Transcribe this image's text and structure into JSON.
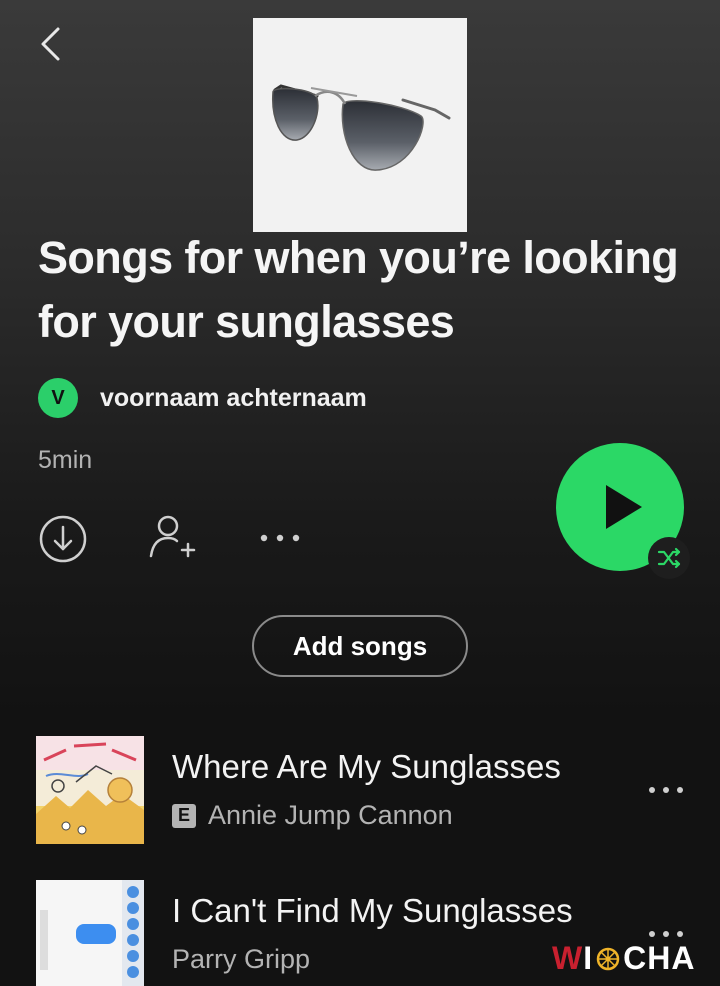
{
  "header": {
    "back_icon": "chevron-left-icon"
  },
  "playlist": {
    "title": "Songs for when you’re looking for your sunglasses",
    "owner_initial": "V",
    "owner_name": "voornaam achternaam",
    "duration": "5min"
  },
  "actions": {
    "download_icon": "download-icon",
    "add_user_icon": "add-user-icon",
    "more_icon": "more-horizontal-icon",
    "play_icon": "play-icon",
    "shuffle_icon": "shuffle-icon",
    "add_songs_label": "Add songs"
  },
  "tracks": [
    {
      "title": "Where Are My Sunglasses",
      "explicit_badge": "E",
      "artist": "Annie Jump Cannon"
    },
    {
      "title": "I Can't Find My Sunglasses",
      "artist": "Parry Gripp"
    }
  ],
  "watermark": {
    "part1": "W",
    "part2": "I",
    "part3": "CHA"
  },
  "colors": {
    "accent_green": "#2bd866",
    "avatar_green": "#2bcf6a",
    "background": "#121212",
    "muted_text": "#b3b3b3"
  }
}
